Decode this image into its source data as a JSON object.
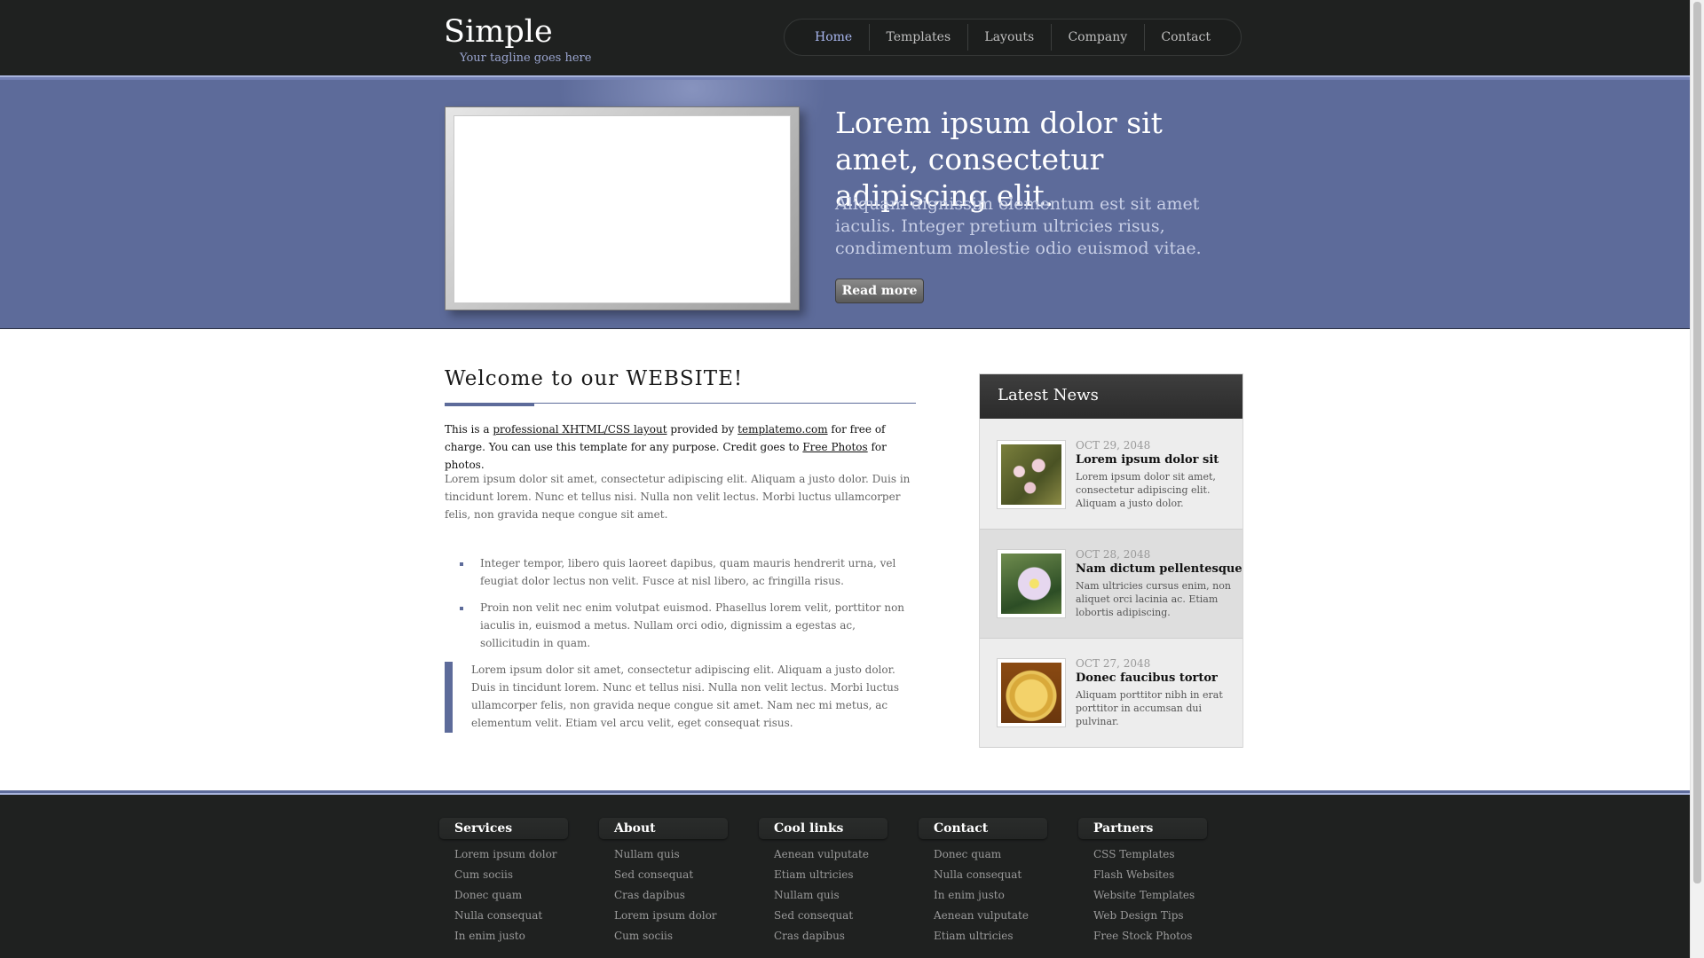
{
  "header": {
    "site_title": "Simple",
    "tagline": "Your tagline goes here",
    "nav": [
      "Home",
      "Templates",
      "Layouts",
      "Company",
      "Contact"
    ]
  },
  "banner": {
    "title": "Lorem ipsum dolor sit amet, consectetur adipiscing elit.",
    "text": "Aliquam dignissim elementum est sit amet iaculis. Integer pretium ultricies risus, condimentum molestie odio euismod vitae.",
    "button": "Read more"
  },
  "welcome": {
    "title": "Welcome to our WEBSITE!",
    "intro": {
      "t1": "This is a ",
      "link1": "professional XHTML/CSS layout",
      "t2": " provided by ",
      "link2": "templatemo.com",
      "t3": " for free of charge. You can use this template for any purpose. Credit goes to ",
      "link3": "Free Photos",
      "t4": " for photos."
    },
    "paragraph": "Lorem ipsum dolor sit amet, consectetur adipiscing elit. Aliquam a justo dolor. Duis in tincidunt lorem. Nunc et tellus nisi. Nulla non velit lectus. Morbi luctus ullamcorper felis, non gravida neque congue sit amet.",
    "bullets": [
      "Integer tempor, libero quis laoreet dapibus, quam mauris hendrerit urna, vel feugiat dolor lectus non velit. Fusce at nisl libero, ac fringilla risus.",
      "Proin non velit nec enim volutpat euismod. Phasellus lorem velit, porttitor non iaculis in, euismod a metus. Nullam orci odio, dignissim a egestas ac, sollicitudin in quam."
    ],
    "quote": "Lorem ipsum dolor sit amet, consectetur adipiscing elit. Aliquam a justo dolor. Duis in tincidunt lorem. Nunc et tellus nisi. Nulla non velit lectus. Morbi luctus ullamcorper felis, non gravida neque congue sit amet. Nam nec mi metus, ac elementum velit. Etiam vel arcu velit, eget consequat risus."
  },
  "news": {
    "heading": "Latest News",
    "items": [
      {
        "date": "OCT 29, 2048",
        "title": "Lorem ipsum dolor sit",
        "text": "Lorem ipsum dolor sit amet, consectetur adipiscing elit. Aliquam a justo dolor.",
        "thumb": "orchid-photo"
      },
      {
        "date": "OCT 28, 2048",
        "title": "Nam dictum pellentesque",
        "text": "Nam ultricies cursus enim, non aliquet orci lacinia ac. Etiam lobortis adipiscing.",
        "thumb": "flower-bee-photo"
      },
      {
        "date": "OCT 27, 2048",
        "title": "Donec faucibus tortor",
        "text": "Aliquam porttitor nibh in erat porttitor in accumsan dui pulvinar.",
        "thumb": "coffee-cup-photo"
      }
    ]
  },
  "footer": {
    "columns": [
      {
        "title": "Services",
        "links": [
          "Lorem ipsum dolor",
          "Cum sociis",
          "Donec quam",
          "Nulla consequat",
          "In enim justo"
        ]
      },
      {
        "title": "About",
        "links": [
          "Nullam quis",
          "Sed consequat",
          "Cras dapibus",
          "Lorem ipsum dolor",
          "Cum sociis"
        ]
      },
      {
        "title": "Cool links",
        "links": [
          "Aenean vulputate",
          "Etiam ultricies",
          "Nullam quis",
          "Sed consequat",
          "Cras dapibus"
        ]
      },
      {
        "title": "Contact",
        "links": [
          "Donec quam",
          "Nulla consequat",
          "In enim justo",
          "Aenean vulputate",
          "Etiam ultricies"
        ]
      },
      {
        "title": "Partners",
        "links": [
          "CSS Templates",
          "Flash Websites",
          "Website Templates",
          "Web Design Tips",
          "Free Stock Photos"
        ]
      }
    ]
  },
  "colors": {
    "header_bg": "#1f2120",
    "banner_bg": "#5d6b9a",
    "accent": "#5d6b9a",
    "nav_active": "#a8b6ee"
  }
}
